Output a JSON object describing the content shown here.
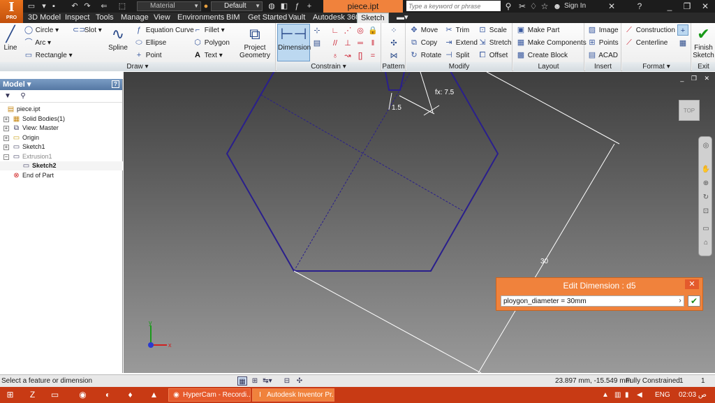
{
  "app": {
    "logo_main": "I",
    "logo_sub": "PRO",
    "document_title": "piece.ipt",
    "material_combo": "Material",
    "appearance_combo": "Default",
    "search_placeholder": "Type a keyword or phrase",
    "sign_in": "Sign In"
  },
  "tabs": [
    "3D Model",
    "Inspect",
    "Tools",
    "Manage",
    "View",
    "Environments",
    "BIM",
    "Get Started",
    "Vault",
    "Autodesk 360",
    "Sketch"
  ],
  "active_tab": "Sketch",
  "ribbon": {
    "draw": {
      "title": "Draw",
      "line": "Line",
      "circle": "Circle",
      "arc": "Arc",
      "rectangle": "Rectangle",
      "slot": "Slot",
      "spline": "Spline",
      "ellipse": "Ellipse",
      "point": "Point",
      "fillet": "Fillet",
      "polygon": "Polygon",
      "text": "Text",
      "project_geometry_1": "Project",
      "project_geometry_2": "Geometry"
    },
    "constrain": {
      "title": "Constrain",
      "dimension": "Dimension"
    },
    "pattern": {
      "title": "Pattern"
    },
    "modify": {
      "title": "Modify",
      "move": "Move",
      "copy": "Copy",
      "rotate": "Rotate",
      "trim": "Trim",
      "extend": "Extend",
      "split": "Split",
      "scale": "Scale",
      "stretch": "Stretch",
      "offset": "Offset"
    },
    "layout": {
      "title": "Layout",
      "make_part": "Make Part",
      "make_components": "Make Components",
      "create_block": "Create Block"
    },
    "insert": {
      "title": "Insert",
      "image": "Image",
      "points": "Points",
      "acad": "ACAD"
    },
    "format": {
      "title": "Format",
      "construction": "Construction",
      "centerline": "Centerline"
    },
    "exit": {
      "title": "Exit",
      "finish_1": "Finish",
      "finish_2": "Sketch"
    }
  },
  "browser": {
    "title": "Model",
    "items": [
      {
        "label": "piece.ipt",
        "bold": false,
        "dim": false
      },
      {
        "label": "Solid Bodies(1)",
        "bold": false,
        "dim": false
      },
      {
        "label": "View: Master",
        "bold": false,
        "dim": false
      },
      {
        "label": "Origin",
        "bold": false,
        "dim": false
      },
      {
        "label": "Sketch1",
        "bold": false,
        "dim": false
      },
      {
        "label": "Extrusion1",
        "bold": false,
        "dim": true
      },
      {
        "label": "Sketch2",
        "bold": true,
        "dim": false
      },
      {
        "label": "End of Part",
        "bold": false,
        "dim": false
      }
    ]
  },
  "viewport": {
    "viewcube_label": "TOP",
    "dim_fx": "fx: 7.5",
    "dim_15": "1.5",
    "dim_30": "30",
    "axis_y": "y",
    "axis_x": "x"
  },
  "edit_dimension": {
    "title": "Edit Dimension : d5",
    "value": "ploygon_diameter = 30mm"
  },
  "status": {
    "message": "Select a feature or dimension",
    "coordinates": "23.897 mm, -15.549 mm",
    "constraint_state": "Fully Constrained",
    "count_1": "1",
    "count_2": "1"
  },
  "taskbar": {
    "tasks": [
      "HyperCam - Recordi...",
      "Autodesk Inventor Pr..."
    ],
    "language": "ENG",
    "time": "02:03 ص"
  },
  "colors": {
    "accent_orange": "#f0823c",
    "sketch_line": "#2a1f8c",
    "taskbar": "#c83a14"
  }
}
